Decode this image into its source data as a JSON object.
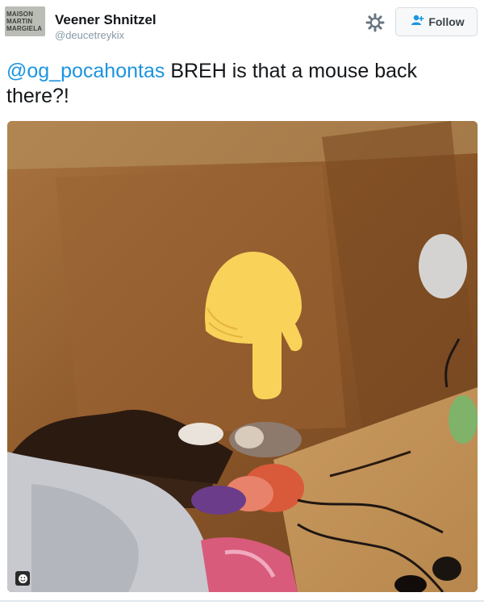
{
  "author": {
    "display_name": "Veener Shnitzel",
    "handle": "@deucetreykix",
    "avatar_text": [
      "MAISON",
      "MARTIN",
      "MARGIELA"
    ]
  },
  "actions": {
    "follow_label": "Follow"
  },
  "tweet": {
    "mention": "@og_pocahontas",
    "text": " BREH is that a mouse back there?!"
  },
  "icons": {
    "settings": "gear-icon",
    "follow": "add-user-icon",
    "pointer": "backhand-index-pointing-down-emoji",
    "media_badge": "smiley-icon"
  },
  "colors": {
    "link": "#1b95e0",
    "emoji_yellow": "#f9d25a"
  }
}
